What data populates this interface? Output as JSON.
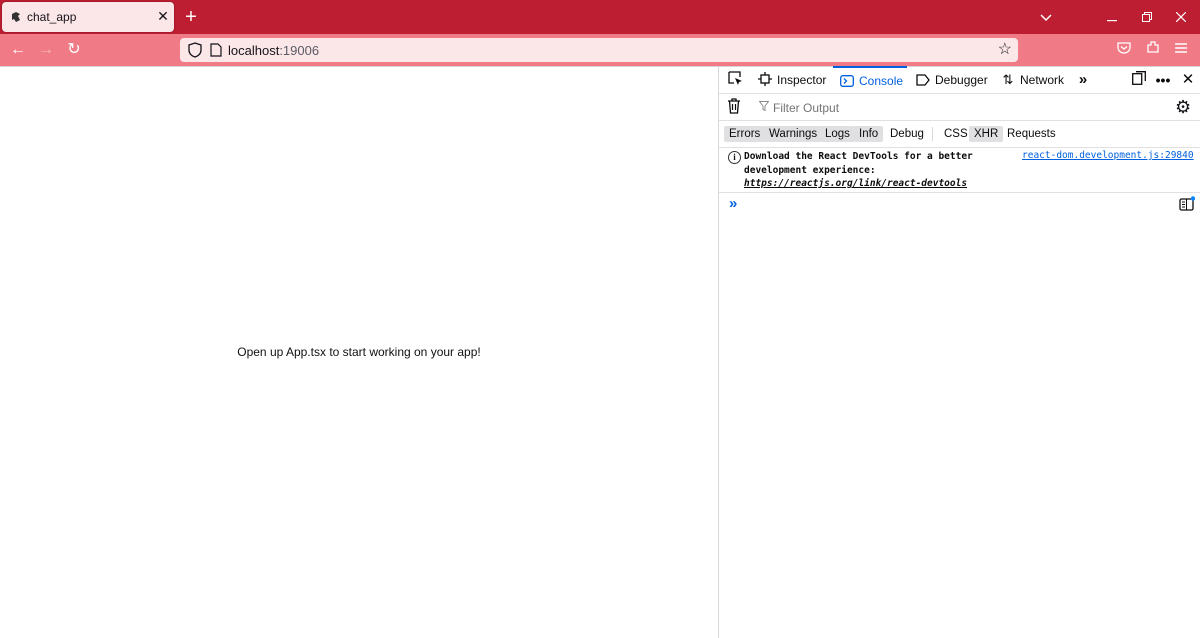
{
  "browser": {
    "tab_title": "chat_app",
    "url_host": "localhost",
    "url_port": ":19006"
  },
  "page": {
    "message": "Open up App.tsx to start working on your app!"
  },
  "devtools": {
    "tabs": [
      {
        "label": "Inspector",
        "icon": "inspector-icon"
      },
      {
        "label": "Console",
        "icon": "console-icon"
      },
      {
        "label": "Debugger",
        "icon": "debugger-icon"
      },
      {
        "label": "Network",
        "icon": "network-icon"
      }
    ],
    "active_tab": "Console",
    "filter_placeholder": "Filter Output",
    "levels": [
      "Errors",
      "Warnings",
      "Logs",
      "Info",
      "Debug"
    ],
    "categories": [
      "CSS",
      "XHR",
      "Requests"
    ],
    "message": {
      "text_before": "Download the React DevTools for a better development experience: ",
      "link": "https://reactjs.org/link/react-devtools",
      "source": "react-dom.development.js:29840"
    },
    "accent_color": "#0060df"
  }
}
